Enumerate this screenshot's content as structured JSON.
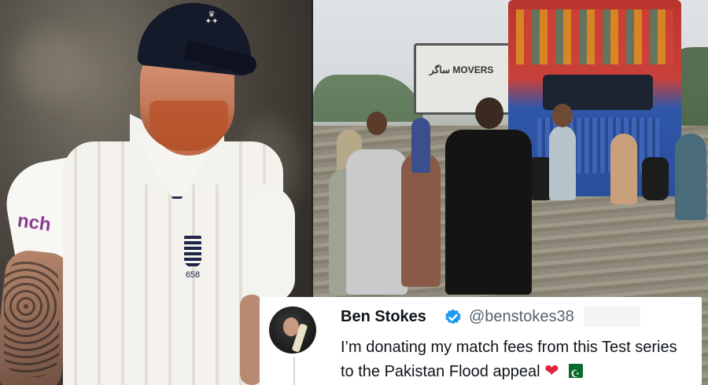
{
  "left_photo": {
    "sponsor_text": "nch",
    "badge_number": "658"
  },
  "right_photo": {
    "truck_sign": "ساگر MOVERS"
  },
  "tweet": {
    "name": "Ben Stokes",
    "handle": "@benstokes38",
    "text": "I’m donating my match fees from this Test series to the Pakistan Flood appeal",
    "icons": [
      "verified-badge-icon",
      "red-heart-icon",
      "pakistan-flag-icon"
    ],
    "colors": {
      "verified": "#1d9bf0",
      "heart": "#e0243a"
    }
  }
}
